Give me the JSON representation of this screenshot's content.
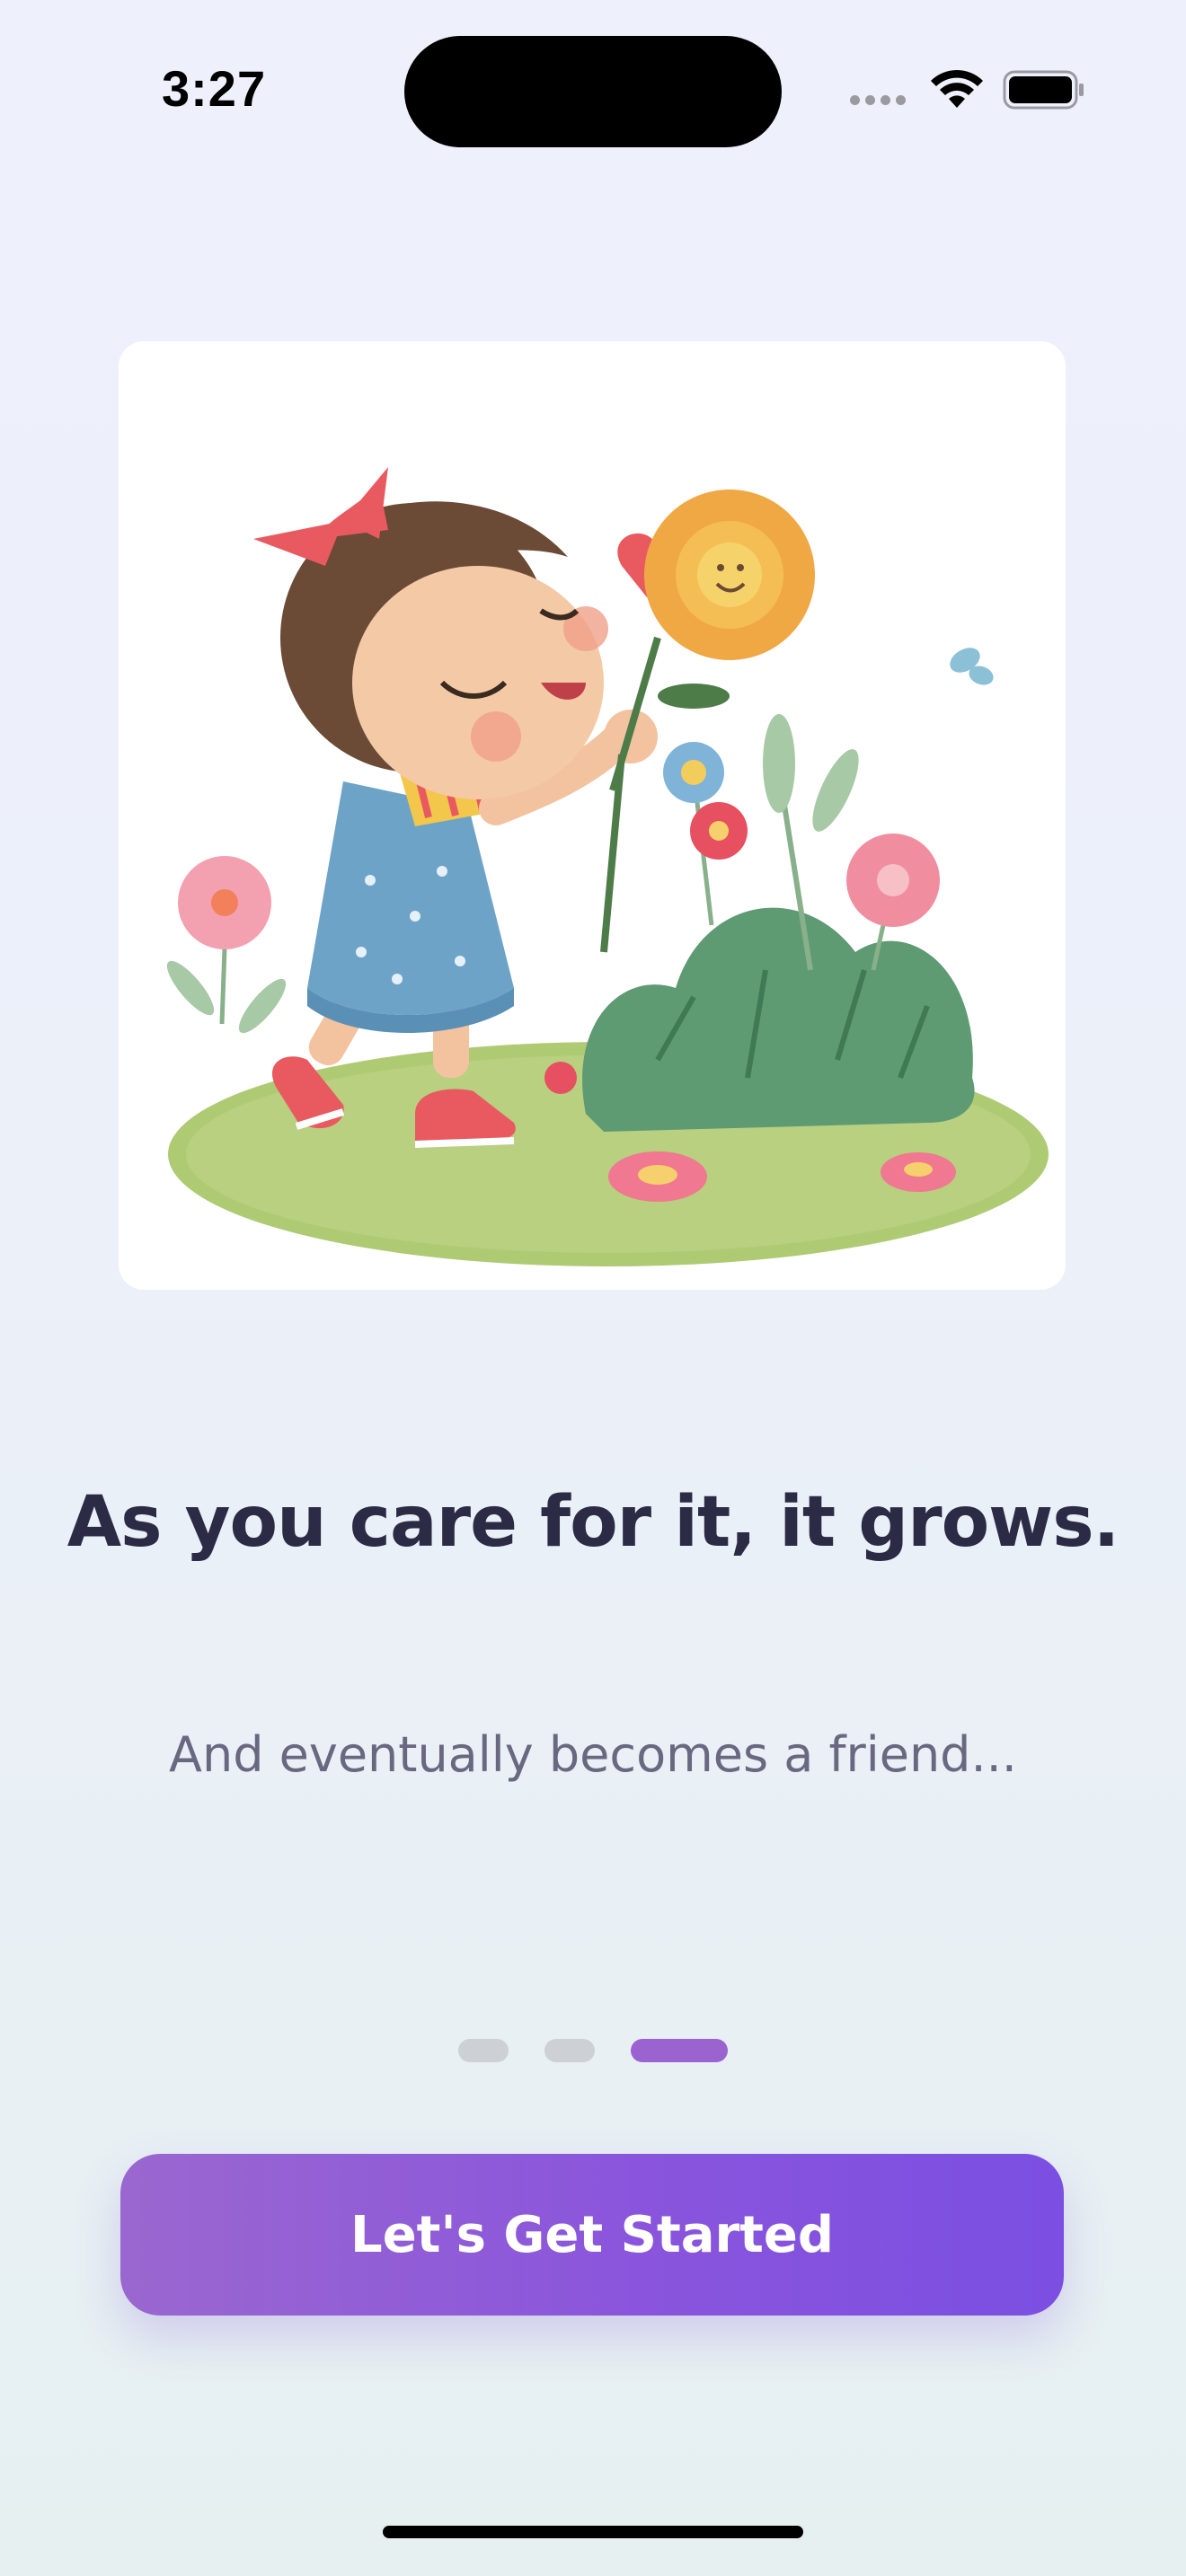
{
  "status_bar": {
    "time": "3:27",
    "icons": [
      "cellular-signal-icon",
      "wifi-icon",
      "battery-icon"
    ]
  },
  "onboarding": {
    "illustration": "girl-smelling-flower-illustration",
    "headline": "As you care for it, it grows.",
    "subtitle": "And eventually becomes a friend...",
    "page_count": 3,
    "current_page": 3
  },
  "cta": {
    "label": "Let's Get Started"
  },
  "colors": {
    "accent": "#8a55dc",
    "active_dot": "#9a63cf",
    "inactive_dot": "#cdd1d6",
    "headline": "#2c2b45",
    "subtitle": "#6a6880"
  }
}
